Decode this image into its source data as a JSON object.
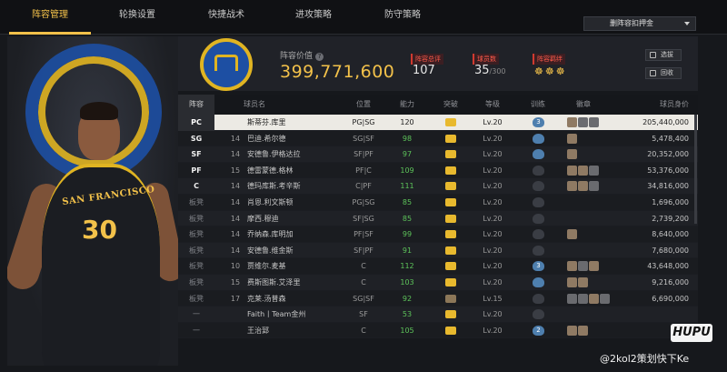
{
  "tabs": [
    "阵容管理",
    "轮换设置",
    "快捷战术",
    "进攻策略",
    "防守策略"
  ],
  "active_tab": 0,
  "dropdown": {
    "label": "删阵容扣押金"
  },
  "summary": {
    "value_label": "阵容价值",
    "value_help": "?",
    "value": "399,771,600",
    "rating_label": "阵容总评",
    "rating": "107",
    "count_label": "球员数",
    "count": "35",
    "count_max": "/300",
    "chem_label": "阵容羁绊",
    "chem_icons": "☸☸☸"
  },
  "buttons": {
    "select": "选拔",
    "recycle": "回收"
  },
  "columns": [
    "阵容",
    "球员名",
    "位置",
    "能力",
    "突破",
    "等级",
    "训练",
    "徽章",
    "球员身价"
  ],
  "rows": [
    {
      "slot": "PC",
      "num": "",
      "name": "斯蒂芬.库里",
      "pos": "PG|SG",
      "ovr": "120",
      "crown": "gold",
      "lv": "Lv.20",
      "train": "3",
      "train_color": "blue",
      "badges": [
        "b",
        "g",
        "g"
      ],
      "salary": "205,440,000",
      "selected": true
    },
    {
      "slot": "SG",
      "num": "14",
      "name": "巴迪.希尔德",
      "pos": "SG|SF",
      "ovr": "98",
      "crown": "gold",
      "lv": "Lv.20",
      "train": "",
      "train_color": "blue",
      "badges": [
        "b"
      ],
      "salary": "5,478,400"
    },
    {
      "slot": "SF",
      "num": "14",
      "name": "安德鲁.伊格达拉",
      "pos": "SF|PF",
      "ovr": "97",
      "crown": "gold",
      "lv": "Lv.20",
      "train": "",
      "train_color": "blue",
      "badges": [
        "b"
      ],
      "salary": "20,352,000"
    },
    {
      "slot": "PF",
      "num": "15",
      "name": "德雷蒙德.格林",
      "pos": "PF|C",
      "ovr": "109",
      "crown": "gold",
      "lv": "Lv.20",
      "train": "",
      "train_color": "grey",
      "badges": [
        "b",
        "b",
        "g"
      ],
      "salary": "53,376,000"
    },
    {
      "slot": "C",
      "num": "14",
      "name": "德玛库斯.考辛斯",
      "pos": "C|PF",
      "ovr": "111",
      "crown": "gold",
      "lv": "Lv.20",
      "train": "",
      "train_color": "grey",
      "badges": [
        "b",
        "b",
        "g"
      ],
      "salary": "34,816,000"
    },
    {
      "slot": "板凳",
      "num": "14",
      "name": "肖恩.利文斯顿",
      "pos": "PG|SG",
      "ovr": "85",
      "crown": "gold",
      "lv": "Lv.20",
      "train": "",
      "train_color": "grey",
      "badges": [],
      "salary": "1,696,000"
    },
    {
      "slot": "板凳",
      "num": "14",
      "name": "摩西.穆迪",
      "pos": "SF|SG",
      "ovr": "85",
      "crown": "gold",
      "lv": "Lv.20",
      "train": "",
      "train_color": "grey",
      "badges": [],
      "salary": "2,739,200"
    },
    {
      "slot": "板凳",
      "num": "14",
      "name": "乔纳森.库明加",
      "pos": "PF|SF",
      "ovr": "99",
      "crown": "gold",
      "lv": "Lv.20",
      "train": "",
      "train_color": "grey",
      "badges": [
        "b"
      ],
      "salary": "8,640,000"
    },
    {
      "slot": "板凳",
      "num": "14",
      "name": "安德鲁.维金斯",
      "pos": "SF|PF",
      "ovr": "91",
      "crown": "gold",
      "lv": "Lv.20",
      "train": "",
      "train_color": "grey",
      "badges": [],
      "salary": "7,680,000"
    },
    {
      "slot": "板凳",
      "num": "10",
      "name": "贾维尔.麦基",
      "pos": "C",
      "ovr": "112",
      "crown": "gold",
      "lv": "Lv.20",
      "train": "3",
      "train_color": "blue",
      "badges": [
        "b",
        "g",
        "b"
      ],
      "salary": "43,648,000"
    },
    {
      "slot": "板凳",
      "num": "15",
      "name": "费斯图斯.艾泽里",
      "pos": "C",
      "ovr": "103",
      "crown": "gold",
      "lv": "Lv.20",
      "train": "",
      "train_color": "blue",
      "badges": [
        "b",
        "b"
      ],
      "salary": "9,216,000"
    },
    {
      "slot": "板凳",
      "num": "17",
      "name": "克莱.汤普森",
      "pos": "SG|SF",
      "ovr": "92",
      "crown": "bronze",
      "lv": "Lv.15",
      "train": "",
      "train_color": "grey",
      "badges": [
        "g",
        "g",
        "b",
        "g"
      ],
      "salary": "6,690,000"
    },
    {
      "slot": "一",
      "num": "",
      "name": "Faith丨Team金州",
      "pos": "SF",
      "ovr": "53",
      "crown": "gold",
      "lv": "Lv.20",
      "train": "",
      "train_color": "grey",
      "badges": [],
      "salary": ""
    },
    {
      "slot": "一",
      "num": "",
      "name": "王治郅",
      "pos": "C",
      "ovr": "105",
      "crown": "gold",
      "lv": "Lv.20",
      "train": "2",
      "train_color": "blue",
      "badges": [
        "b",
        "b"
      ],
      "salary": ""
    }
  ],
  "player_art": {
    "team": "SAN FRANCISCO",
    "number": "30"
  },
  "watermark": {
    "logo": "HUPU",
    "text": "@2kol2策划快下Ke"
  }
}
